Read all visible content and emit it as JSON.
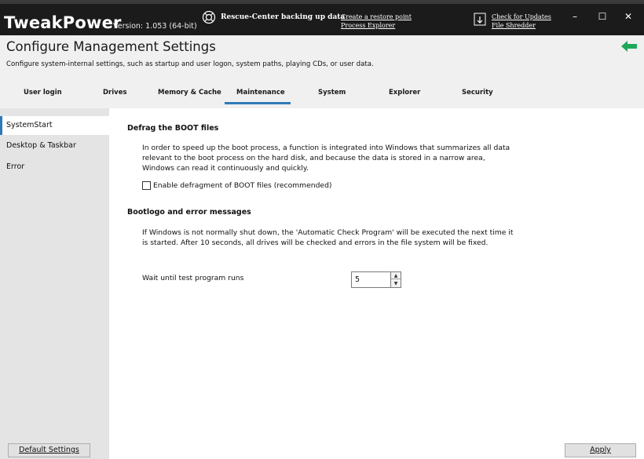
{
  "app": {
    "title": "TweakPower",
    "version": "Version: 1.053 (64-bit)",
    "rescue_status": "Rescue-Center backing up data",
    "links": {
      "create_restore_point": "Create a restore point",
      "process_explorer": "Process Explorer",
      "check_updates": "Check for Updates",
      "file_shredder": "File Shredder"
    },
    "window_controls": {
      "minimize": "–",
      "maximize": "☐",
      "close": "✕"
    }
  },
  "header": {
    "title": "Configure Management Settings",
    "description": "Configure system-internal settings, such as startup and user logon, system paths, playing CDs, or user data.",
    "back_icon": "back-arrow-icon",
    "accent_color": "#1fa85a"
  },
  "tabs": [
    {
      "label": "User login",
      "active": false
    },
    {
      "label": "Drives",
      "active": false
    },
    {
      "label": "Memory & Cache",
      "active": false
    },
    {
      "label": "Maintenance",
      "active": true
    },
    {
      "label": "System",
      "active": false
    },
    {
      "label": "Explorer",
      "active": false
    },
    {
      "label": "Security",
      "active": false
    }
  ],
  "sidebar": {
    "items": [
      {
        "label": "SystemStart",
        "active": true
      },
      {
        "label": "Desktop & Taskbar",
        "active": false
      },
      {
        "label": "Error",
        "active": false
      }
    ],
    "default_button": "Default Settings"
  },
  "main": {
    "section1": {
      "title": "Defrag the BOOT files",
      "text": "In order to speed up the boot process, a function is integrated into Windows that summarizes all data relevant to the boot process on the hard disk, and because the data is stored in a narrow area, Windows can read it continuously and quickly.",
      "checkbox_label": "Enable defragment of BOOT files (recommended)",
      "checkbox_checked": false
    },
    "section2": {
      "title": "Bootlogo and error messages",
      "text": "If Windows is not normally shut down, the 'Automatic Check Program' will be executed the next time it is started. After 10 seconds, all drives will be checked and errors in the file system will be fixed.",
      "wait_label": "Wait until test program runs",
      "wait_value": "5"
    },
    "apply_button": "Apply"
  },
  "colors": {
    "topbar": "#1b1b1b",
    "active_tab_underline": "#2e7ab8",
    "sidebar_bg": "#e4e4e4",
    "header_bg": "#f0f0f0"
  }
}
